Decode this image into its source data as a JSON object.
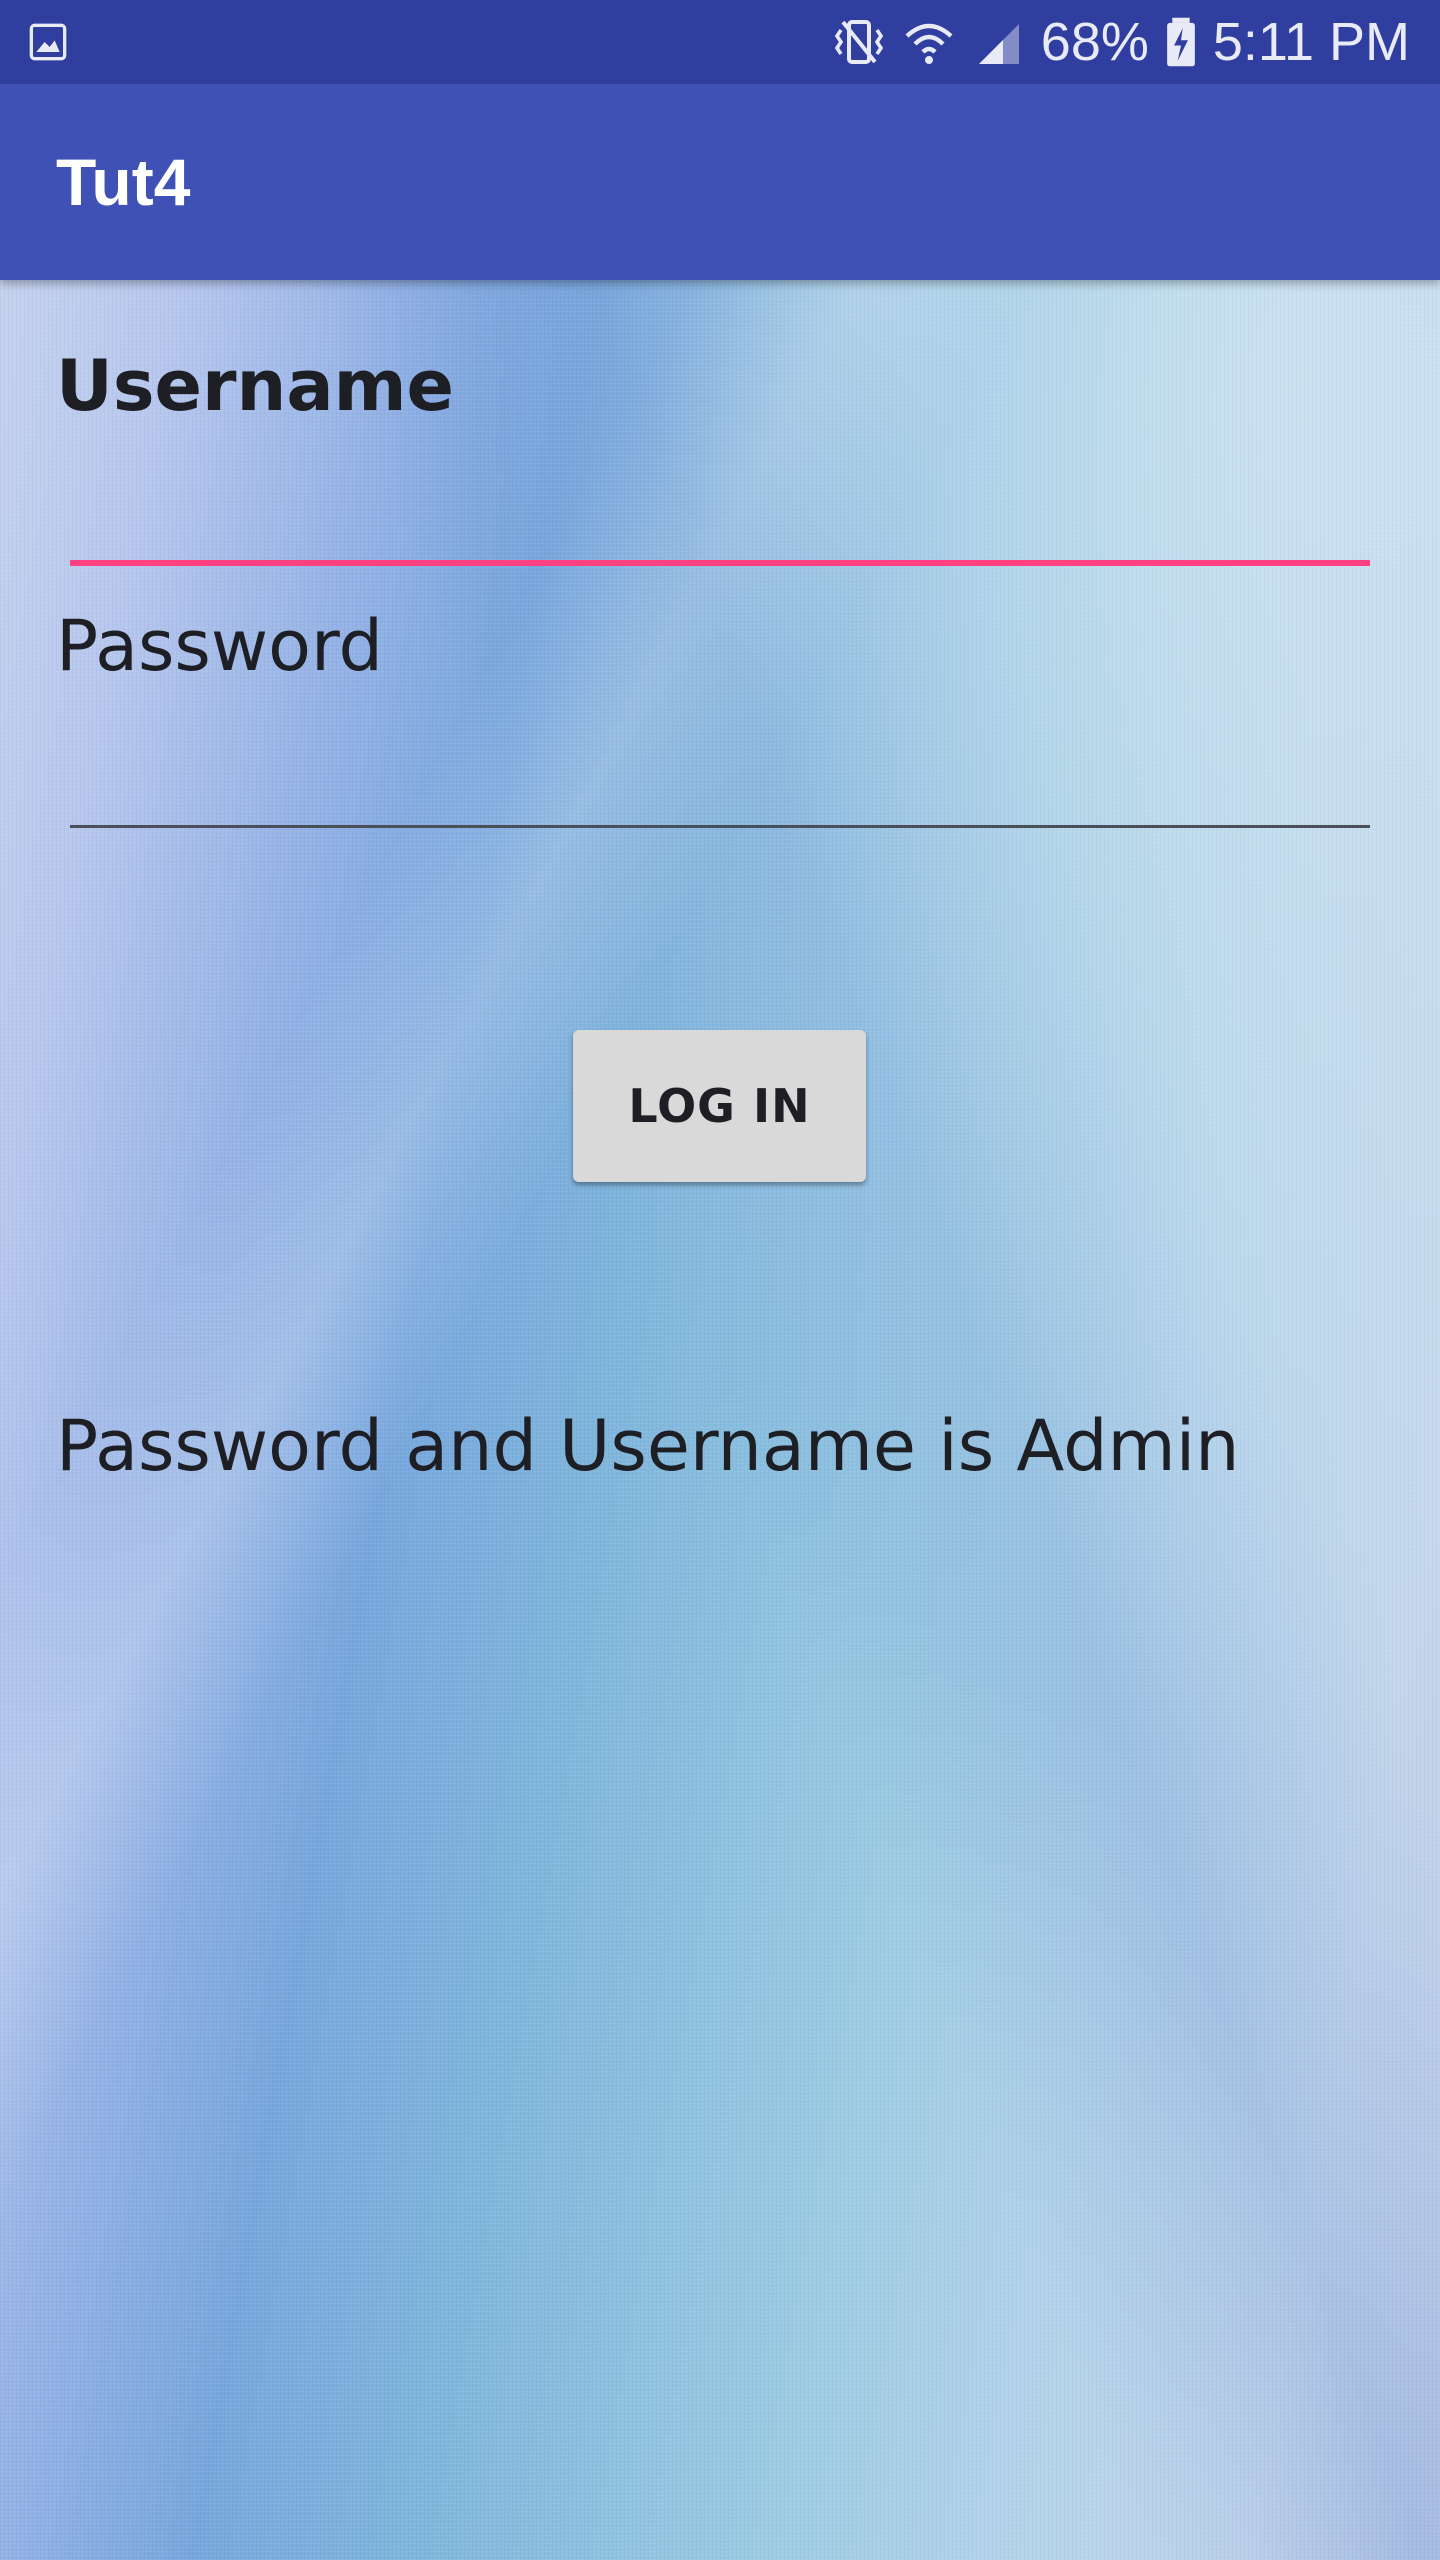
{
  "status_bar": {
    "battery": "68%",
    "time": "5:11 PM",
    "icons": [
      "image-notification-icon",
      "vibrate-icon",
      "wifi-icon",
      "signal-icon",
      "battery-charging-icon"
    ]
  },
  "toolbar": {
    "title": "Tut4"
  },
  "form": {
    "username_label": "Username",
    "username_value": "",
    "password_label": "Password",
    "password_value": "",
    "login_label": "LOG IN"
  },
  "hint": "Password and Username is Admin",
  "colors": {
    "status_bar": "#303f9f",
    "toolbar": "#3f51b5",
    "accent": "#ff4081",
    "button": "#d9d9d9"
  }
}
